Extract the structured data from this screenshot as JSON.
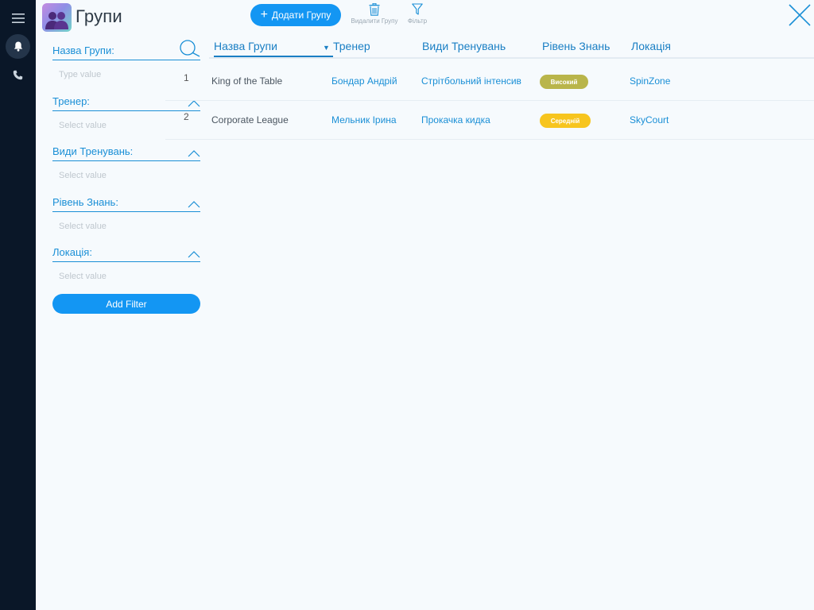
{
  "header": {
    "title": "Групи",
    "add_label": "Додати Групу",
    "delete_label": "Видалити Групу",
    "filter_label": "Фільтр"
  },
  "filters": {
    "items": [
      {
        "label": "Назва Групи:",
        "placeholder": "Type value"
      },
      {
        "label": "Тренер:",
        "placeholder": "Select value"
      },
      {
        "label": "Види Тренувань:",
        "placeholder": "Select value"
      },
      {
        "label": "Рівень Знань:",
        "placeholder": "Select value"
      },
      {
        "label": "Локація:",
        "placeholder": "Select value"
      }
    ],
    "add_filter_label": "Add Filter"
  },
  "table": {
    "columns": [
      "Назва Групи",
      "Тренер",
      "Види Тренувань",
      "Рівень Знань",
      "Локація"
    ],
    "rows": [
      {
        "num": "1",
        "name": "King of the Table",
        "trainer": "Бондар Андрій",
        "training": "Стрітбольний інтенсив",
        "level": "Високий",
        "level_color": "#b9b54a",
        "location": "SpinZone"
      },
      {
        "num": "2",
        "name": "Corporate League",
        "trainer": "Мельник Ірина",
        "training": "Прокачка кидка",
        "level": "Середній",
        "level_color": "#f7c51e",
        "location": "SkyCourt"
      }
    ]
  },
  "colors": {
    "accent": "#1396f3",
    "rail": "#0a1728"
  }
}
